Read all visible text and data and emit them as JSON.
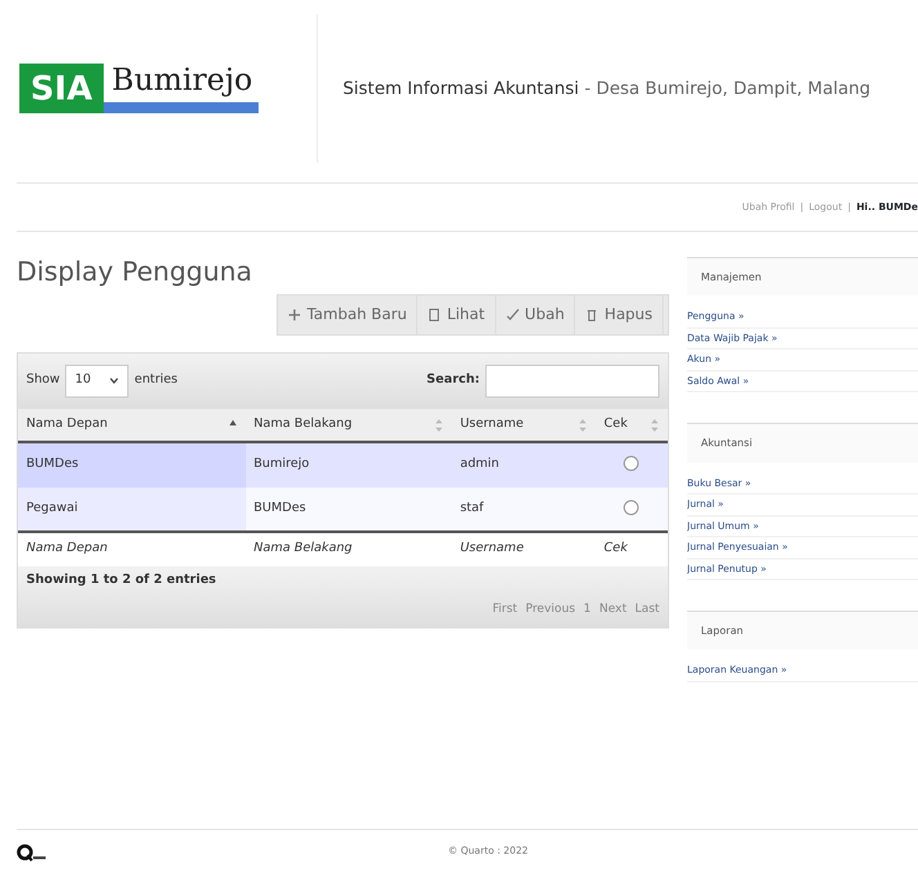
{
  "header": {
    "logo": {
      "mark": "SIA",
      "name": "Bumirejo"
    },
    "title": "Sistem Informasi Akuntansi",
    "subtitle": "- Desa Bumirejo, Dampit, Malang"
  },
  "user_links": [
    {
      "label": "Ubah Profil",
      "kind": "link"
    },
    {
      "label": "|",
      "kind": "separator"
    },
    {
      "label": "Logout",
      "kind": "link"
    },
    {
      "label": "|",
      "kind": "separator"
    },
    {
      "label": "Hi.. BUMDe",
      "kind": "greeting"
    }
  ],
  "page_title": "Display Pengguna",
  "toolbar": [
    {
      "label": "Tambah Baru",
      "kind": "add"
    },
    {
      "label": "Lihat",
      "kind": "view"
    },
    {
      "label": "Ubah",
      "kind": "edit"
    },
    {
      "label": "Hapus",
      "kind": "delete"
    }
  ],
  "table": {
    "length_label_before": "Show",
    "length_value": "10",
    "length_label_after": "entries",
    "search_label": "Search:",
    "columns": [
      {
        "label": "Nama Depan",
        "sorted": true
      },
      {
        "label": "Nama Belakang",
        "sorted": false
      },
      {
        "label": "Username",
        "sorted": false
      },
      {
        "label": "Cek",
        "sorted": false
      }
    ],
    "rows": [
      {
        "cells": [
          "BUMDes",
          "Bumirejo",
          "admin"
        ],
        "checked": false
      },
      {
        "cells": [
          "Pegawai",
          "BUMDes",
          "staf"
        ],
        "checked": false
      }
    ],
    "footer": [
      "Nama Depan",
      "Nama Belakang",
      "Username",
      "Cek"
    ],
    "info": "Showing 1 to 2 of 2 entries",
    "pagination": [
      "First",
      "Previous",
      "1",
      "Next",
      "Last"
    ]
  },
  "sidebar": [
    {
      "heading": "Manajemen",
      "items": [
        "Pengguna »",
        "Data Wajib Pajak »",
        "Akun »",
        "Saldo Awal »"
      ]
    },
    {
      "heading": "Akuntansi",
      "items": [
        "Buku Besar »",
        "Jurnal »",
        "Jurnal Umum »",
        "Jurnal Penyesuaian »",
        "Jurnal Penutup »"
      ]
    },
    {
      "heading": "Laporan",
      "items": [
        "Laporan Keuangan »"
      ]
    }
  ],
  "footer": {
    "copyright": "© Quarto : 2022"
  }
}
